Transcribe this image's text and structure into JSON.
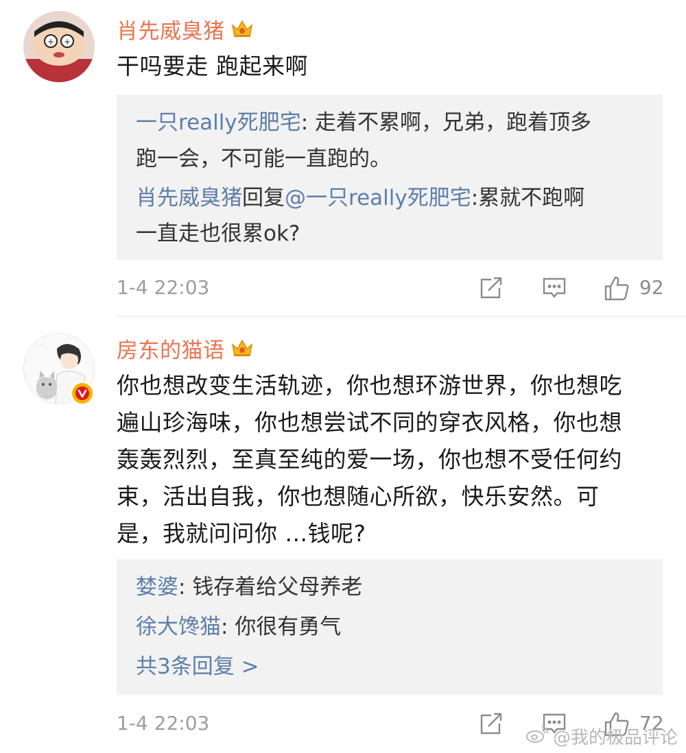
{
  "comments": [
    {
      "user": "肖先威臭猪",
      "text": "干吗要走 跑起来啊",
      "replies": [
        {
          "user": "一只really死肥宅",
          "sep": ": ",
          "line1": "走着不累啊，兄弟，跑着顶多",
          "line2": "跑一会，不可能一直跑的。"
        },
        {
          "user": "肖先威臭猪",
          "mid": "回复",
          "mention": "@一只really死肥宅",
          "sep": ":",
          "line1": "累就不跑啊",
          "line2": "一直走也很累ok?"
        }
      ],
      "time": "1-4 22:03",
      "likes": "92"
    },
    {
      "user": "房东的猫语",
      "text_lines": [
        "你也想改变生活轨迹，你也想环游世界，你也想吃",
        "遍山珍海味，你也想尝试不同的穿衣风格，你也想",
        "轰轰烈烈，至真至纯的爱一场，你也想不受任何约",
        "束，活出自我，你也想随心所欲，快乐安然。可",
        "是，我就问问你 ...钱呢?"
      ],
      "replies": [
        {
          "user": "婪婆",
          "sep": ": ",
          "text": "钱存着给父母养老"
        },
        {
          "user": "徐大馋猫",
          "sep": ": ",
          "text": "你很有勇气"
        }
      ],
      "more_replies": "共3条回复 >",
      "time": "1-4 22:03",
      "likes": "72"
    }
  ],
  "watermark": "@我的极品评论",
  "colors": {
    "username": "#eb7350",
    "reply_user": "#5d7eab",
    "reply_bg": "#f2f2f2",
    "meta": "#9c9c9c"
  },
  "icons": [
    "crown-icon",
    "repost-icon",
    "comment-icon",
    "like-icon",
    "verified-badge-icon",
    "weibo-logo-icon"
  ]
}
